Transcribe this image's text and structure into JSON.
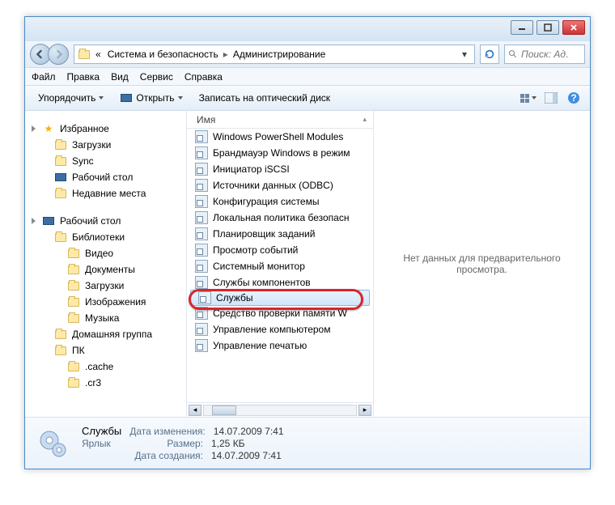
{
  "titlebar": {
    "min": "–",
    "max": "▢",
    "close": "✕"
  },
  "address": {
    "back_aria": "Назад",
    "fwd_aria": "Вперёд",
    "prefix": "«",
    "crumb1": "Система и безопасность",
    "crumb2": "Администрирование",
    "refresh_aria": "Обновить",
    "search_placeholder": "Поиск: Ад…"
  },
  "menu": {
    "file": "Файл",
    "edit": "Правка",
    "view": "Вид",
    "tools": "Сервис",
    "help": "Справка"
  },
  "toolbar": {
    "organize": "Упорядочить",
    "open": "Открыть",
    "burn": "Записать на оптический диск",
    "view_aria": "Изменить представление",
    "preview_aria": "Панель предпросмотра",
    "help_aria": "Справка"
  },
  "nav": {
    "favorites": "Избранное",
    "downloads": "Загрузки",
    "sync": "Sync",
    "desktop_fav": "Рабочий стол",
    "recent": "Недавние места",
    "desktop": "Рабочий стол",
    "libraries": "Библиотеки",
    "videos": "Видео",
    "documents": "Документы",
    "downloads2": "Загрузки",
    "pictures": "Изображения",
    "music": "Музыка",
    "homegroup": "Домашняя группа",
    "pc": "ПК",
    "cache": ".cache",
    "cr3": ".cr3"
  },
  "column_header": "Имя",
  "files": [
    "Windows PowerShell Modules",
    "Брандмауэр Windows в режим",
    "Инициатор iSCSI",
    "Источники данных (ODBC)",
    "Конфигурация системы",
    "Локальная политика безопасн",
    "Планировщик заданий",
    "Просмотр событий",
    "Системный монитор",
    "Службы компонентов",
    "Службы",
    "Средство проверки памяти W",
    "Управление компьютером",
    "Управление печатью"
  ],
  "selected_index": 10,
  "preview_empty": "Нет данных для предварительного просмотра.",
  "details": {
    "name": "Службы",
    "type": "Ярлык",
    "modified_label": "Дата изменения:",
    "modified_value": "14.07.2009 7:41",
    "size_label": "Размер:",
    "size_value": "1,25 КБ",
    "created_label": "Дата создания:",
    "created_value": "14.07.2009 7:41"
  }
}
